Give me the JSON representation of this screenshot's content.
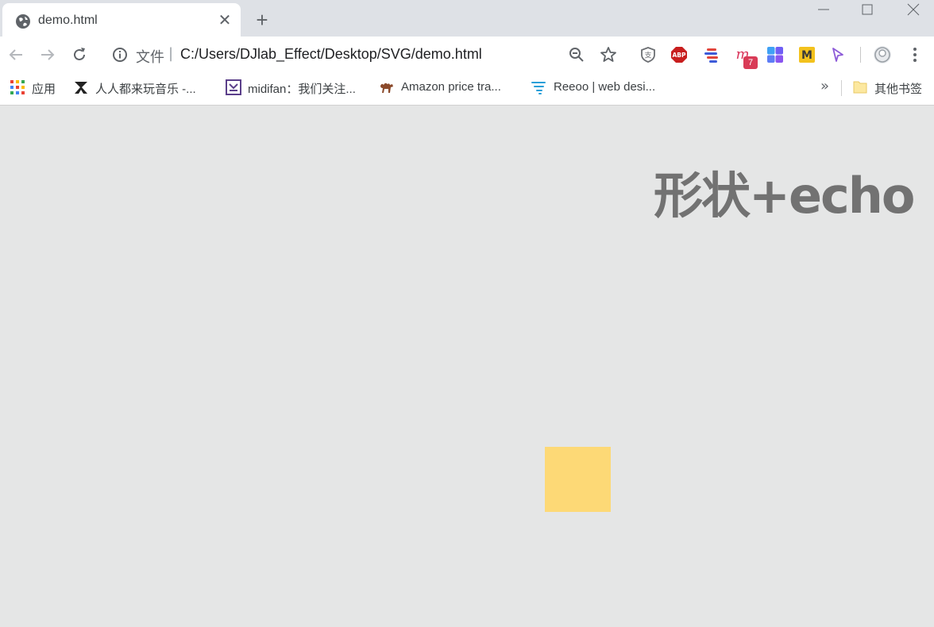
{
  "tab": {
    "title": "demo.html"
  },
  "toolbar": {
    "scheme_label": "文件",
    "url": "C:/Users/DJlab_Effect/Desktop/SVG/demo.html",
    "extension_badge": "7"
  },
  "bookmarks": {
    "items": [
      {
        "label": "应用"
      },
      {
        "label": "人人都来玩音乐 -..."
      },
      {
        "label": "midifan：我们关注..."
      },
      {
        "label": "Amazon price tra..."
      },
      {
        "label": "Reeoo | web desi..."
      }
    ],
    "overflow": "»",
    "other": "其他书签"
  },
  "page": {
    "heading": "形状+echo",
    "shape_color": "#fdd976",
    "background": "#e5e6e6"
  }
}
